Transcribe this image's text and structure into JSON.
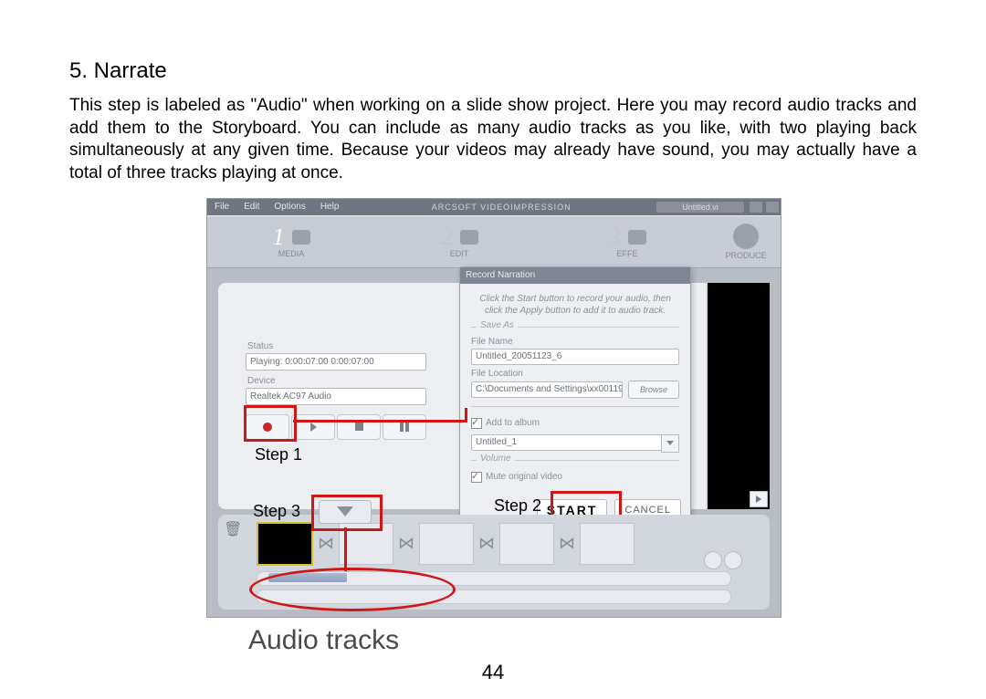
{
  "heading": "5. Narrate",
  "paragraph": "This step is labeled as \"Audio\" when working on a slide show project. Here you may record audio tracks and add them to the Storyboard.   You can include as many audio tracks as you like, with two playing back simultaneously at any given time. Because your videos may already have sound, you may actually have a total of three tracks playing at once.",
  "page_number": "44",
  "caption": "Audio tracks",
  "annotations": {
    "step1": "Step 1",
    "step2": "Step 2",
    "step3": "Step 3"
  },
  "menubar": {
    "items": [
      "File",
      "Edit",
      "Options",
      "Help"
    ],
    "app_title": "ARCSOFT VIDEOIMPRESSION",
    "doc_name": "Untitled.vi"
  },
  "tabs": {
    "t1_num": "1",
    "t1_label": "MEDIA",
    "t2_num": "2",
    "t2_label": "EDIT",
    "t3_num": "3",
    "t3_label": "EFFE",
    "t4_label": "PRODUCE"
  },
  "left_panel": {
    "status_label": "Status",
    "status_value": "Playing:   0:00:07:00  0:00:07:00",
    "device_label": "Device",
    "device_value": "Realtek AC97 Audio"
  },
  "dialog": {
    "title": "Record Narration",
    "hint": "Click the Start button to record your audio, then click the Apply button to add it to audio track.",
    "save_as_group": "Save As",
    "file_name_label": "File Name",
    "file_name_value": "Untitled_20051123_6",
    "file_location_label": "File Location",
    "file_location_value": "C:\\Documents and Settings\\xx00119",
    "browse": "Browse",
    "add_group": "Add to album",
    "album_value": "Untitled_1",
    "volume_group": "Volume",
    "mute_label": "Mute original video",
    "start": "START",
    "cancel": "CANCEL"
  }
}
